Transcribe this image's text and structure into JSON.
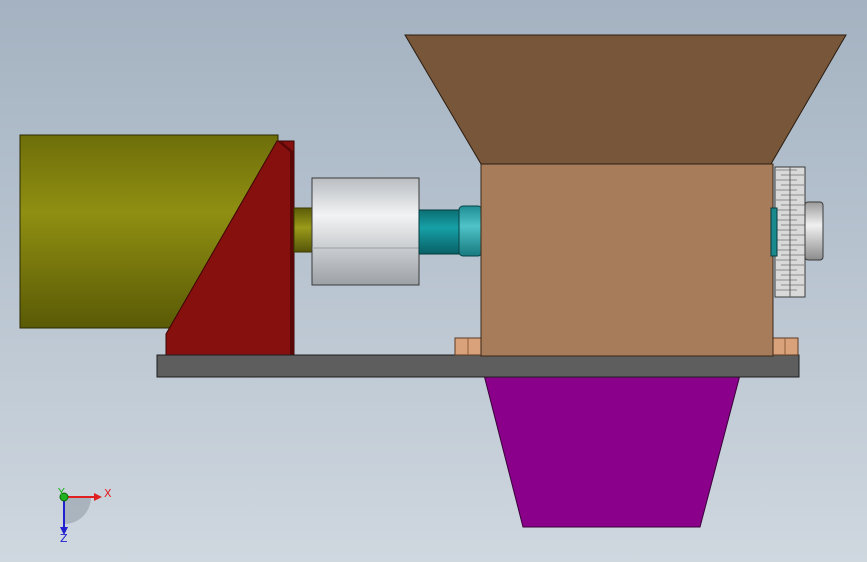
{
  "viewport": {
    "background_top": "#a4b2c1",
    "background_bottom": "#cfd7df"
  },
  "parts": {
    "motor": {
      "color": "#8a8a10",
      "shade": "#5f5f08"
    },
    "motor_bracket": {
      "color": "#85100e",
      "shade": "#5a0807"
    },
    "motor_shaft": {
      "color": "#7d7d10"
    },
    "coupling": {
      "color": "#d9dcdf",
      "shade": "#8e9398"
    },
    "drive_shaft": {
      "color": "#0f8a8f"
    },
    "bearing_collar": {
      "color": "#2fa3a8"
    },
    "hopper": {
      "color": "#77563a"
    },
    "crusher_housing": {
      "color": "#a67c5a"
    },
    "gear": {
      "color": "#d9d9d9",
      "shade": "#8a8a8a"
    },
    "shaft_end": {
      "color": "#d5d5d5"
    },
    "base_plate": {
      "color": "#5e5e5e"
    },
    "mounting_feet": {
      "color": "#d9a27a"
    },
    "discharge_chute": {
      "color": "#8b008b"
    }
  },
  "triad": {
    "x_label": "X",
    "y_label": "Y",
    "z_label": "Z",
    "x_color": "#e02020",
    "y_color": "#20b020",
    "z_color": "#2020d0"
  }
}
